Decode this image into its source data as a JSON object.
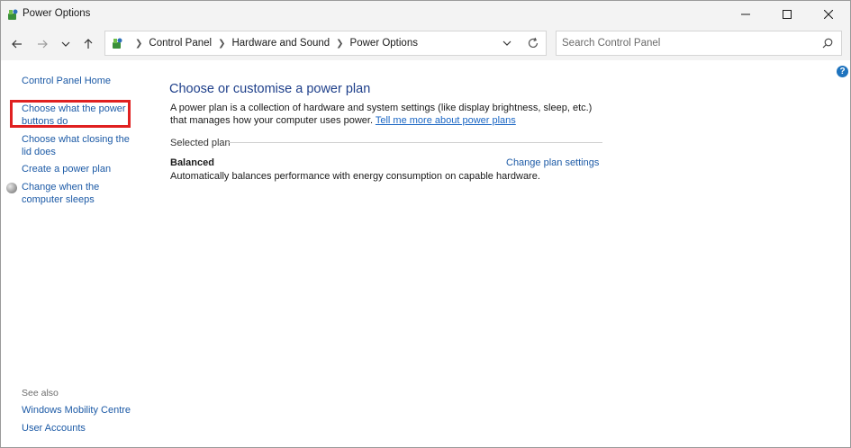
{
  "window": {
    "title": "Power Options",
    "controls": {
      "minimize": "minimize-icon",
      "maximize": "maximize-icon",
      "close": "close-icon"
    }
  },
  "nav": {
    "breadcrumbs": [
      "Control Panel",
      "Hardware and Sound",
      "Power Options"
    ],
    "search_placeholder": "Search Control Panel"
  },
  "sidebar": {
    "home": "Control Panel Home",
    "items": [
      "Choose what the power buttons do",
      "Choose what closing the lid does",
      "Create a power plan",
      "Change when the computer sleeps"
    ],
    "see_also_label": "See also",
    "see_also": [
      "Windows Mobility Centre",
      "User Accounts"
    ]
  },
  "main": {
    "title": "Choose or customise a power plan",
    "description": "A power plan is a collection of hardware and system settings (like display brightness, sleep, etc.) that manages how your computer uses power.",
    "learn_more": "Tell me more about power plans",
    "selected_plan_label": "Selected plan",
    "plan": {
      "name": "Balanced",
      "change_link": "Change plan settings",
      "description": "Automatically balances performance with energy consumption on capable hardware."
    }
  },
  "colors": {
    "accent": "#1c5aa6",
    "heading": "#1e3f8a",
    "highlight_border": "#e02020"
  }
}
